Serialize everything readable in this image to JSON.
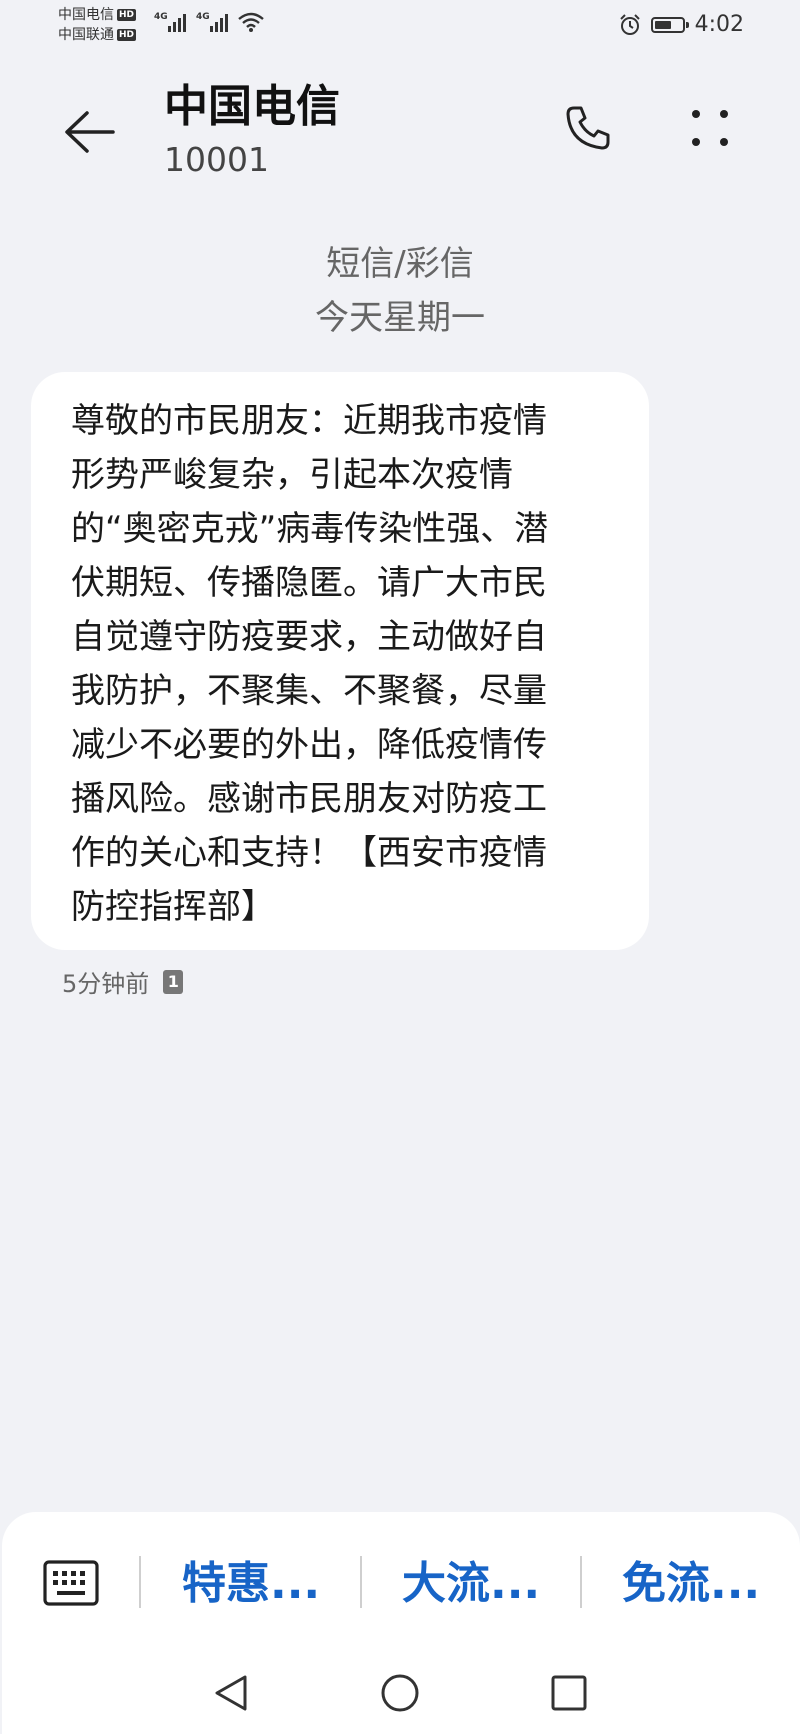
{
  "status_bar": {
    "carrier_1": "中国电信",
    "carrier_2": "中国联通",
    "hd": "HD",
    "network_type": "4G",
    "time": "4:02",
    "battery_level": 0.6
  },
  "header": {
    "contact_name": "中国电信",
    "contact_number": "10001"
  },
  "thread": {
    "type_label": "短信/彩信",
    "date_label": "今天星期一"
  },
  "message": {
    "text": "尊敬的市民朋友：近期我市疫情\n形势严峻复杂，引起本次疫情\n的“奥密克戎”病毒传染性强、潜\n伏期短、传播隐匿。请广大市民\n自觉遵守防疫要求，主动做好自\n我防护，不聚集、不聚餐，尽量\n减少不必要的外出，降低疫情传\n播风险。感谢市民朋友对防疫工\n作的关心和支持！【西安市疫情\n防控指挥部】",
    "time_label": "5分钟前",
    "sim_label": "1"
  },
  "quick_replies": [
    {
      "label": "特惠..."
    },
    {
      "label": "大流..."
    },
    {
      "label": "免流..."
    }
  ],
  "colors": {
    "background": "#f1f2f6",
    "accent": "#1764c7"
  }
}
